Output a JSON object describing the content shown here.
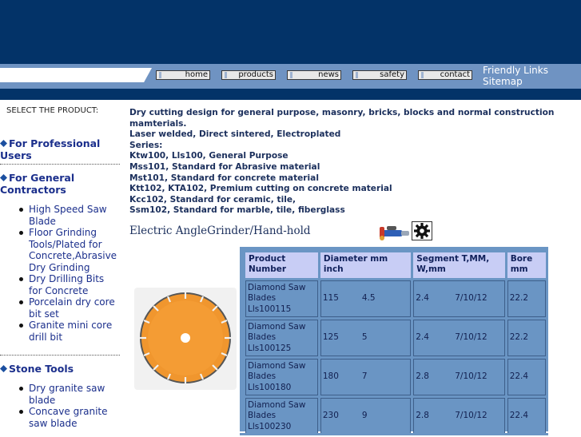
{
  "header": {
    "nav_buttons": [
      "home",
      "products",
      "news",
      "safety",
      "contact"
    ],
    "side_links": [
      "Friendly Links",
      "Sitemap"
    ]
  },
  "sidebar": {
    "select_label": "SELECT THE PRODUCT:",
    "categories": [
      {
        "label": "For Professional Users",
        "items": []
      },
      {
        "label": "For General Contractors",
        "items": [
          "High Speed Saw Blade",
          "Floor Grinding Tools/Plated for Concrete,Abrasive Dry Grinding",
          "Dry Drilling Bits for Concrete",
          "Porcelain dry core bit set",
          "Granite mini core drill bit"
        ]
      },
      {
        "label": "Stone Tools",
        "items": [
          "Dry granite saw blade",
          "Concave granite saw blade"
        ]
      }
    ]
  },
  "main": {
    "description": [
      "Dry cutting design for general purpose, masonry, bricks, blocks and normal construction",
      "mamterials.",
      "Laser welded, Direct sintered, Electroplated",
      "Series:",
      "Ktw100, Lls100, General Purpose",
      "Mss101, Standard for Abrasive material",
      "Mst101, Standard for concrete material",
      "Ktt102, KTA102, Premium cutting on concrete material",
      "Kcc102, Standard for ceramic, tile,",
      "Ssm102, Standard for marble, tile, fiberglass"
    ],
    "section_title": "Electric AngleGrinder/Hand-hold",
    "table": {
      "headers": [
        "Product Number",
        "Diameter mm inch",
        "Segment T,MM, W,mm",
        "Bore mm"
      ],
      "rows": [
        {
          "name": "Diamond Saw Blades Lls100115",
          "dia_mm": "115",
          "dia_in": "4.5",
          "seg_t": "2.4",
          "seg_w": "7/10/12",
          "bore": "22.2"
        },
        {
          "name": "Diamond Saw Blades Lls100125",
          "dia_mm": "125",
          "dia_in": "5",
          "seg_t": "2.4",
          "seg_w": "7/10/12",
          "bore": "22.2"
        },
        {
          "name": "Diamond Saw Blades Lls100180",
          "dia_mm": "180",
          "dia_in": "7",
          "seg_t": "2.8",
          "seg_w": "7/10/12",
          "bore": "22.4"
        },
        {
          "name": "Diamond Saw Blades Lls100230",
          "dia_mm": "230",
          "dia_in": "9",
          "seg_t": "2.8",
          "seg_w": "7/10/12",
          "bore": "22.4"
        }
      ]
    }
  },
  "colors": {
    "banner": "#033368",
    "navbar": "#6f93c2",
    "link_text": "#1b2f8c",
    "table_bg": "#6a95c4",
    "table_header": "#c8cdf5",
    "blade": "#f0962e"
  },
  "icons": [
    "diamond-bullet-icon",
    "angle-grinder-icon",
    "gear-icon",
    "saw-blade-image"
  ]
}
